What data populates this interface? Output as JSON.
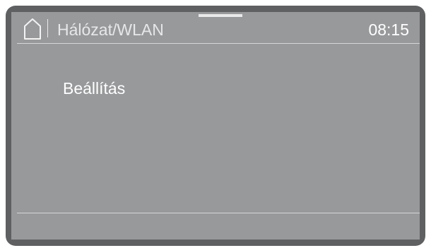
{
  "header": {
    "home_icon": "home-icon",
    "title": "Hálózat/WLAN",
    "time": "08:15"
  },
  "menu": {
    "items": [
      {
        "label": "Beállítás"
      }
    ]
  },
  "colors": {
    "bezel": "#5f6062",
    "screen": "#98999b",
    "text": "#ffffff"
  }
}
